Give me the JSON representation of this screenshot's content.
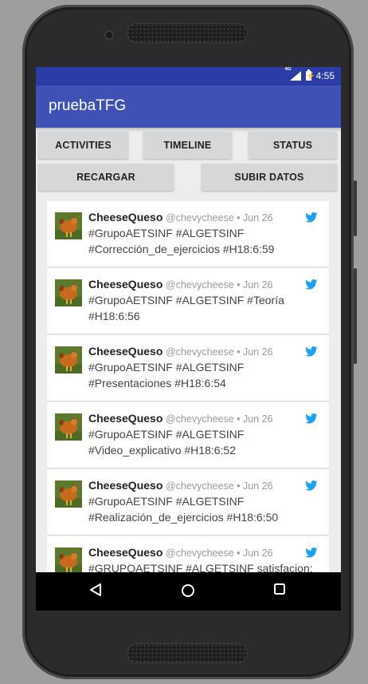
{
  "statusbar": {
    "network": "4G",
    "time": "4:55"
  },
  "appbar": {
    "title": "pruebaTFG"
  },
  "buttons": {
    "activities": "ACTIVITIES",
    "timeline": "TIMELINE",
    "status": "STATUS",
    "recargar": "RECARGAR",
    "subir": "SUBIR DATOS"
  },
  "tweets": [
    {
      "name": "CheeseQueso",
      "meta": "@chevycheese • Jun 26",
      "text": "#GrupoAETSINF #ALGETSINF #Corrección_de_ejercicios #H18:6:59"
    },
    {
      "name": "CheeseQueso",
      "meta": "@chevycheese • Jun 26",
      "text": "#GrupoAETSINF #ALGETSINF #Teoría #H18:6:56"
    },
    {
      "name": "CheeseQueso",
      "meta": "@chevycheese • Jun 26",
      "text": "#GrupoAETSINF #ALGETSINF #Presentaciones #H18:6:54"
    },
    {
      "name": "CheeseQueso",
      "meta": "@chevycheese • Jun 26",
      "text": "#GrupoAETSINF #ALGETSINF #Video_explicativo #H18:6:52"
    },
    {
      "name": "CheeseQueso",
      "meta": "@chevycheese • Jun 26",
      "text": "#GrupoAETSINF #ALGETSINF #Realización_de_ejercicios #H18:6:50"
    },
    {
      "name": "CheeseQueso",
      "meta": "@chevycheese • Jun 26",
      "text": "#GRUPOAETSINF #ALGETSINF  satisfacion:"
    }
  ],
  "colors": {
    "statusbar": "#2c3ca7",
    "appbar": "#3f51b5",
    "twitter": "#1da1f2"
  },
  "icons": {
    "tweet_source": "twitter-bird-icon",
    "nav_back": "back-icon",
    "nav_home": "home-icon",
    "nav_recents": "recents-icon"
  }
}
